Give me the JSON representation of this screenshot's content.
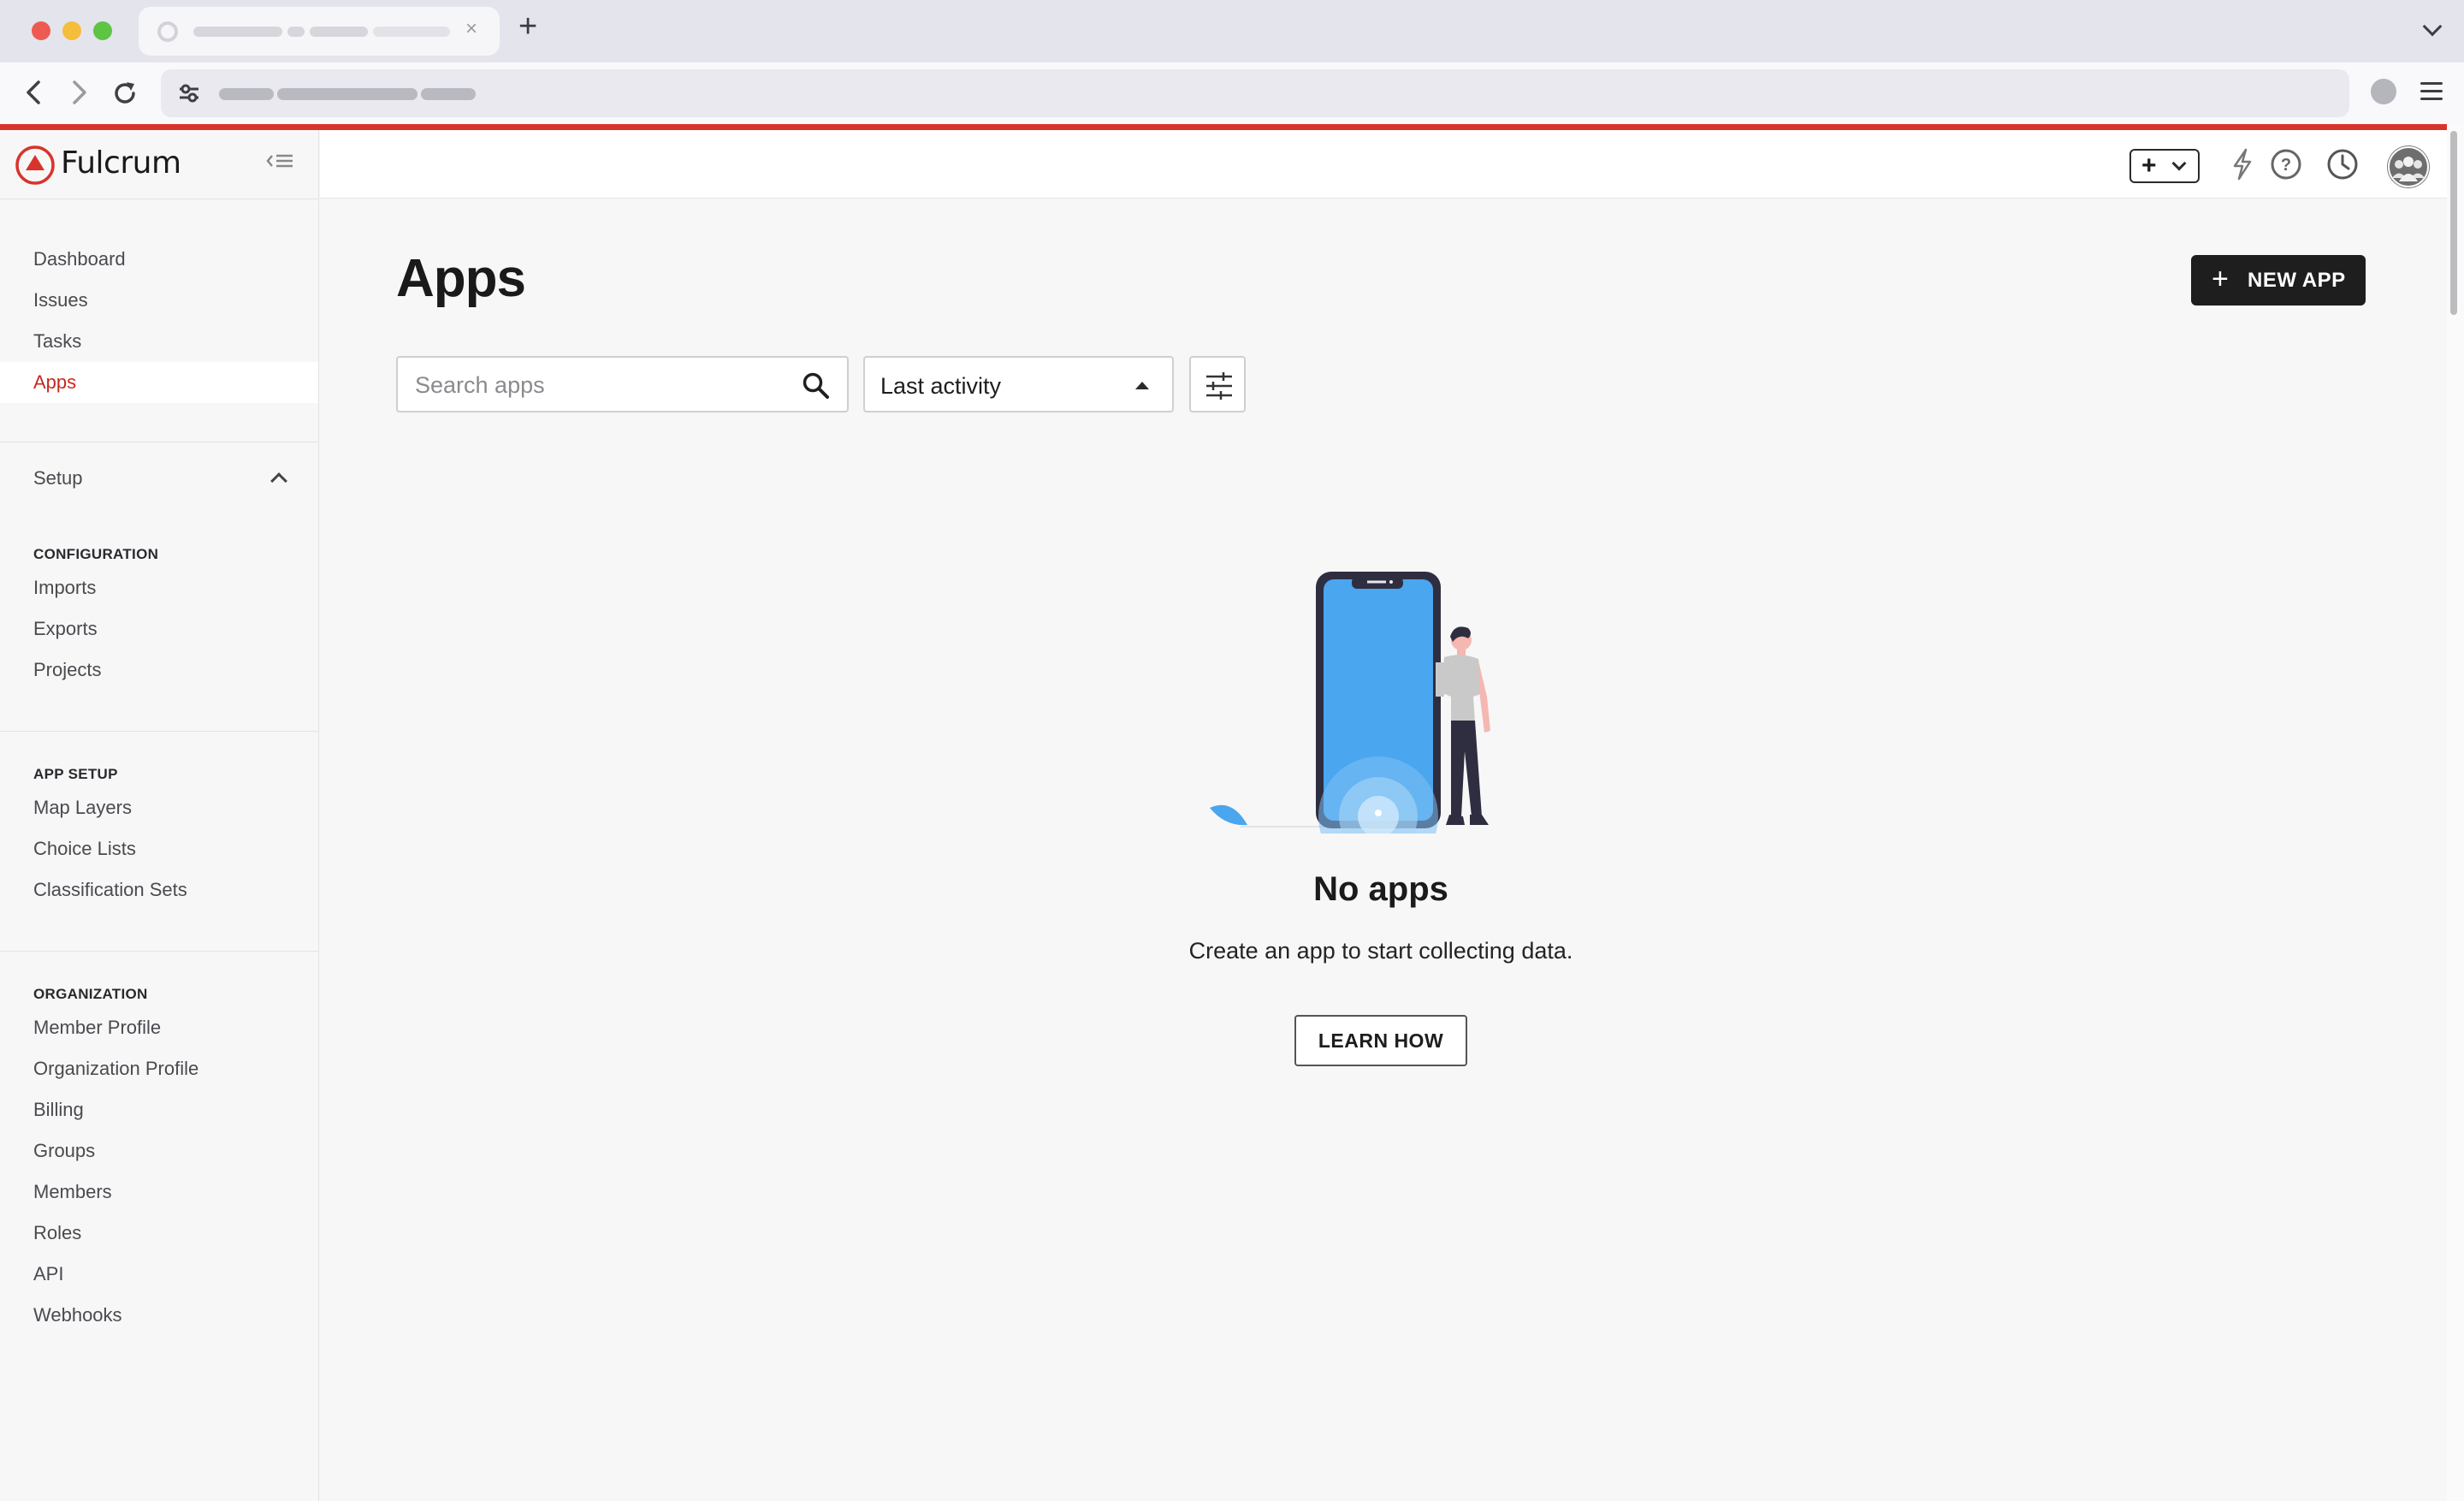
{
  "app": {
    "brand_name": "Fulcrum",
    "accent_color": "#d8342b"
  },
  "sidebar": {
    "primary": [
      {
        "label": "Dashboard"
      },
      {
        "label": "Issues"
      },
      {
        "label": "Tasks"
      },
      {
        "label": "Apps",
        "active": true
      }
    ],
    "setup_label": "Setup",
    "groups": [
      {
        "heading": "CONFIGURATION",
        "items": [
          "Imports",
          "Exports",
          "Projects"
        ]
      },
      {
        "heading": "APP SETUP",
        "items": [
          "Map Layers",
          "Choice Lists",
          "Classification Sets"
        ]
      },
      {
        "heading": "ORGANIZATION",
        "items": [
          "Member Profile",
          "Organization Profile",
          "Billing",
          "Groups",
          "Members",
          "Roles",
          "API",
          "Webhooks"
        ]
      }
    ]
  },
  "header": {
    "add_label": "+",
    "icons": [
      "plus-dropdown-icon",
      "lightning-icon",
      "help-icon",
      "clock-icon",
      "avatar-icon"
    ]
  },
  "main": {
    "title": "Apps",
    "new_app_label": "NEW APP",
    "search": {
      "placeholder": "Search apps",
      "value": ""
    },
    "sort": {
      "selected": "Last activity"
    },
    "empty": {
      "title": "No apps",
      "description": "Create an app to start collecting data.",
      "button": "LEARN HOW"
    }
  }
}
